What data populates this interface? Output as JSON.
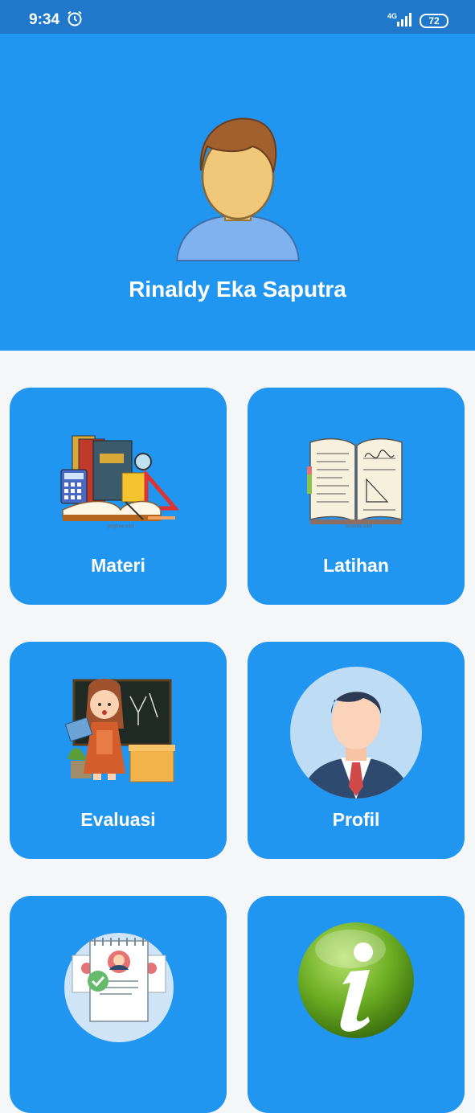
{
  "status_bar": {
    "time": "9:34",
    "network": "4G",
    "battery": "72",
    "icons": [
      "alarm-icon",
      "signal-icon",
      "battery-icon"
    ]
  },
  "header": {
    "user_name": "Rinaldy Eka Saputra",
    "avatar_icon": "user-avatar-icon"
  },
  "menu": {
    "items": [
      {
        "label": "Materi",
        "icon": "books-icon"
      },
      {
        "label": "Latihan",
        "icon": "open-book-icon"
      },
      {
        "label": "Evaluasi",
        "icon": "teacher-icon"
      },
      {
        "label": "Profil",
        "icon": "profile-man-icon"
      },
      {
        "label": "",
        "icon": "resume-check-icon"
      },
      {
        "label": "",
        "icon": "info-icon"
      }
    ]
  },
  "colors": {
    "primary": "#2196f0",
    "status_bar": "#1f78c9",
    "background": "#f5f6f8"
  }
}
